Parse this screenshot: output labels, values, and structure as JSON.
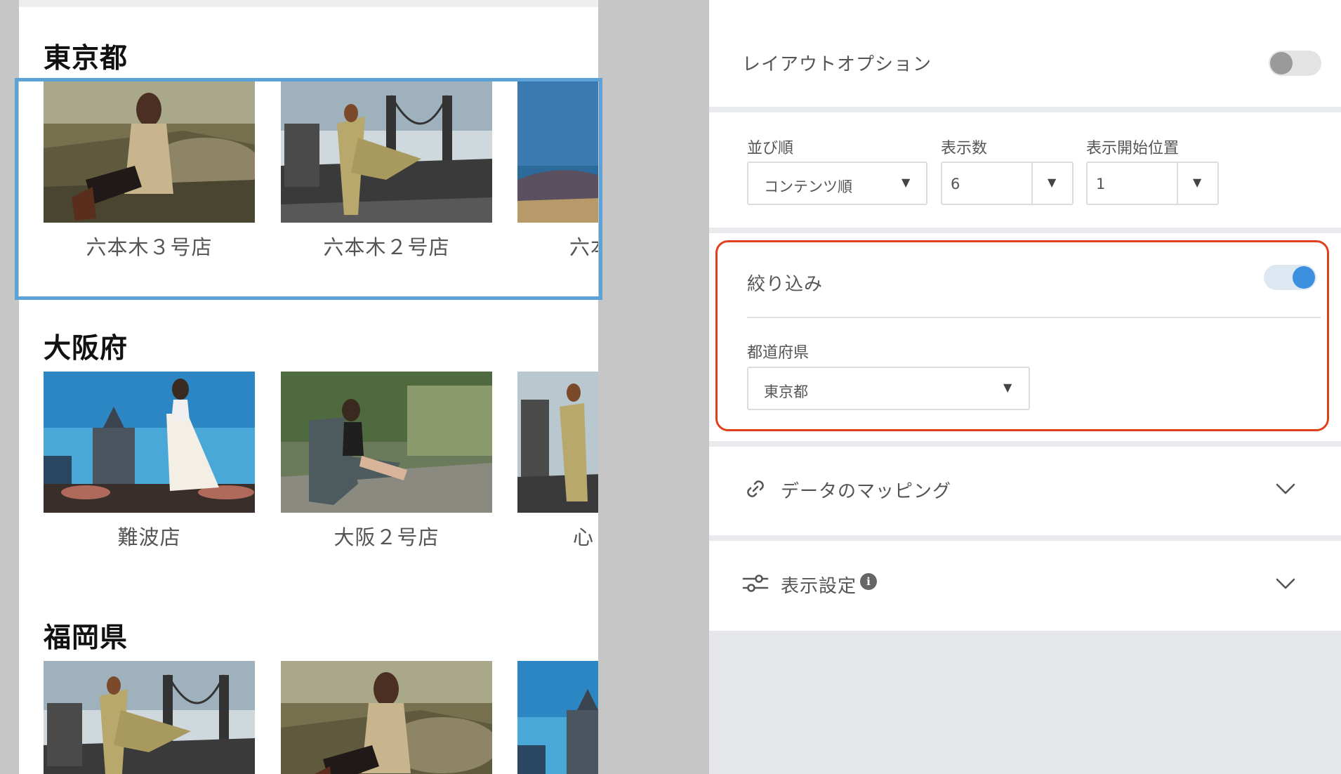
{
  "preview": {
    "sections": [
      {
        "heading": "東京都",
        "cards": [
          "六本木３号店",
          "六本木２号店",
          "六本"
        ]
      },
      {
        "heading": "大阪府",
        "cards": [
          "難波店",
          "大阪２号店",
          "心"
        ]
      },
      {
        "heading": "福岡県",
        "cards": [
          "",
          "",
          ""
        ]
      }
    ]
  },
  "panel": {
    "layout_option": {
      "label": "レイアウトオプション",
      "enabled": false
    },
    "sort": {
      "label": "並び順",
      "value": "コンテンツ順"
    },
    "count": {
      "label": "表示数",
      "value": "6"
    },
    "start": {
      "label": "表示開始位置",
      "value": "1"
    },
    "filter": {
      "label": "絞り込み",
      "enabled": true
    },
    "prefecture": {
      "label": "都道府県",
      "value": "東京都"
    },
    "mapping": {
      "label": "データのマッピング"
    },
    "display_settings": {
      "label": "表示設定"
    }
  },
  "colors": {
    "accent_blue": "#3d8fe0",
    "selection_frame": "#5aa2d8",
    "filter_highlight": "#e2401c"
  }
}
